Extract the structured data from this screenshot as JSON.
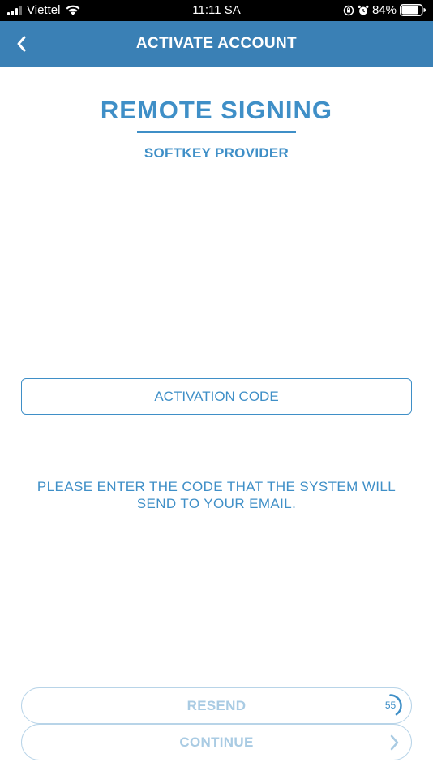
{
  "status_bar": {
    "carrier": "Viettel",
    "time": "11:11 SA",
    "battery_percent": "84%",
    "battery_level": 0.84,
    "signal_bars_active": 3,
    "signal_bars_total": 4
  },
  "nav": {
    "title": "ACTIVATE ACCOUNT",
    "back_icon": "chevron-left-icon"
  },
  "hero": {
    "title": "REMOTE SIGNING",
    "subtitle": "SOFTKEY PROVIDER"
  },
  "form": {
    "activation_placeholder": "ACTIVATION CODE",
    "activation_value": ""
  },
  "instruction": "PLEASE ENTER THE CODE THAT THE SYSTEM WILL SEND TO YOUR EMAIL.",
  "buttons": {
    "resend_label": "RESEND",
    "countdown": "55",
    "countdown_progress": 0.4,
    "continue_label": "CONTINUE"
  },
  "colors": {
    "primary": "#3f8fc7",
    "nav_background": "#3a80b5",
    "disabled_text": "#a9cbe3",
    "disabled_border": "#b8d4e8"
  }
}
